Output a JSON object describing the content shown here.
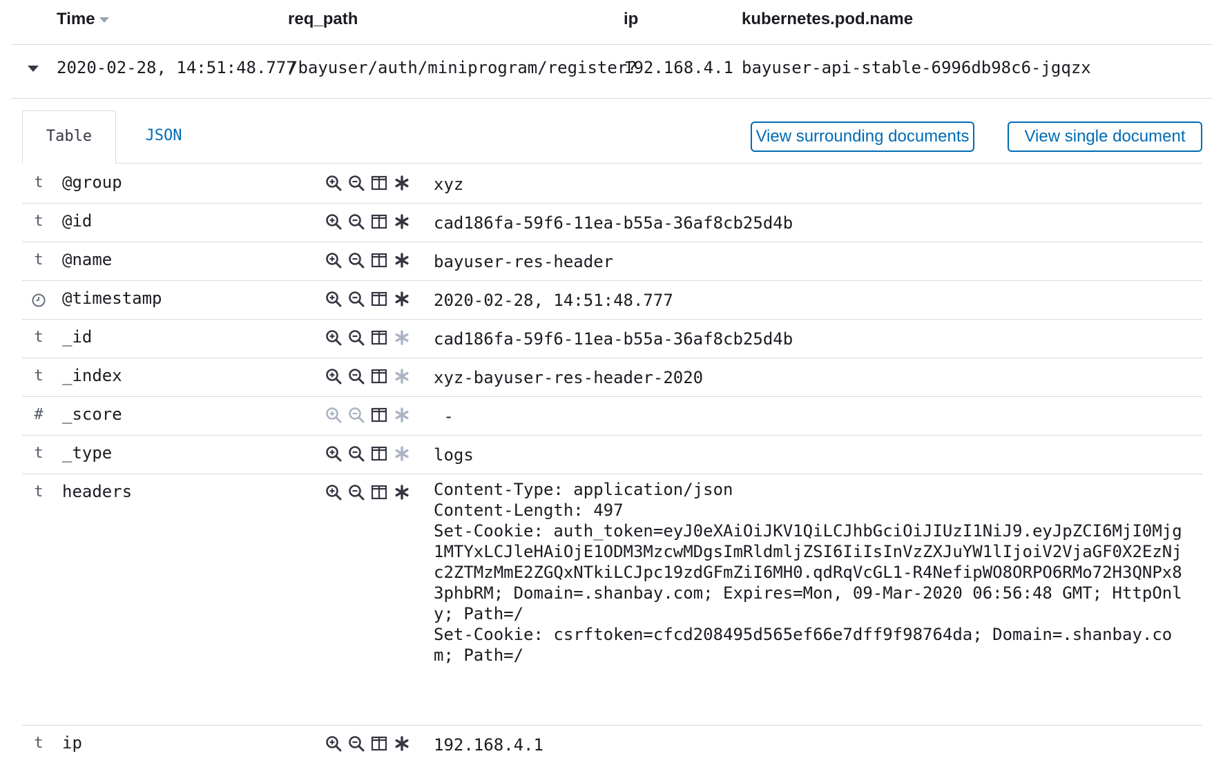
{
  "columns": {
    "time": "Time",
    "req_path": "req_path",
    "ip": "ip",
    "pod_name": "kubernetes.pod.name"
  },
  "summary": {
    "time": "2020-02-28, 14:51:48.777",
    "req_path": "/bayuser/auth/miniprogram/register?",
    "ip": "192.168.4.1",
    "pod_name": "bayuser-api-stable-6996db98c6-jgqzx"
  },
  "tabs": {
    "table": "Table",
    "json": "JSON"
  },
  "buttons": {
    "surrounding": "View surrounding documents",
    "single": "View single document"
  },
  "fields": [
    {
      "type": "t",
      "name": "@group",
      "value": "xyz",
      "filter_enabled": true,
      "exists_active": true
    },
    {
      "type": "t",
      "name": "@id",
      "value": "cad186fa-59f6-11ea-b55a-36af8cb25d4b",
      "filter_enabled": true,
      "exists_active": true
    },
    {
      "type": "t",
      "name": "@name",
      "value": "bayuser-res-header",
      "filter_enabled": true,
      "exists_active": true
    },
    {
      "type": "clock-icon",
      "name": "@timestamp",
      "value": "2020-02-28, 14:51:48.777",
      "filter_enabled": true,
      "exists_active": true
    },
    {
      "type": "t",
      "name": "_id",
      "value": "cad186fa-59f6-11ea-b55a-36af8cb25d4b",
      "filter_enabled": true,
      "exists_active": false
    },
    {
      "type": "t",
      "name": "_index",
      "value": "xyz-bayuser-res-header-2020",
      "filter_enabled": true,
      "exists_active": false
    },
    {
      "type": "#",
      "name": "_score",
      "value": " -",
      "filter_enabled": false,
      "exists_active": false
    },
    {
      "type": "t",
      "name": "_type",
      "value": "logs",
      "filter_enabled": true,
      "exists_active": false
    },
    {
      "type": "t",
      "name": "headers",
      "value": "Content-Type: application/json\nContent-Length: 497\nSet-Cookie: auth_token=eyJ0eXAiOiJKV1QiLCJhbGciOiJIUzI1NiJ9.eyJpZCI6MjI0Mjg\n1MTYxLCJleHAiOjE1ODM3MzcwMDgsImRldmljZSI6IiIsInVzZXJuYW1lIjoiV2VjaGF0X2EzNj\nc2ZTMzMmE2ZGQxNTkiLCJpc19zdGFmZiI6MH0.qdRqVcGL1-R4NefipWO8ORPO6RMo72H3QNPx8\n3phbRM; Domain=.shanbay.com; Expires=Mon, 09-Mar-2020 06:56:48 GMT; HttpOnl\ny; Path=/\nSet-Cookie: csrftoken=cfcd208495d565ef66e7dff9f98764da; Domain=.shanbay.co\nm; Path=/",
      "filter_enabled": true,
      "exists_active": true
    },
    {
      "type": "t",
      "name": "ip",
      "value": "192.168.4.1",
      "filter_enabled": true,
      "exists_active": true
    }
  ],
  "colors": {
    "accent": "#006bb4",
    "border": "#d3dae6",
    "text": "#1a1c21",
    "icon": "#343741",
    "icon_disabled": "#abb4c4"
  },
  "icons": {
    "filter_for": "magnify-plus-icon",
    "filter_out": "magnify-minus-icon",
    "toggle_column": "column-icon",
    "filter_exists": "asterisk-icon"
  }
}
